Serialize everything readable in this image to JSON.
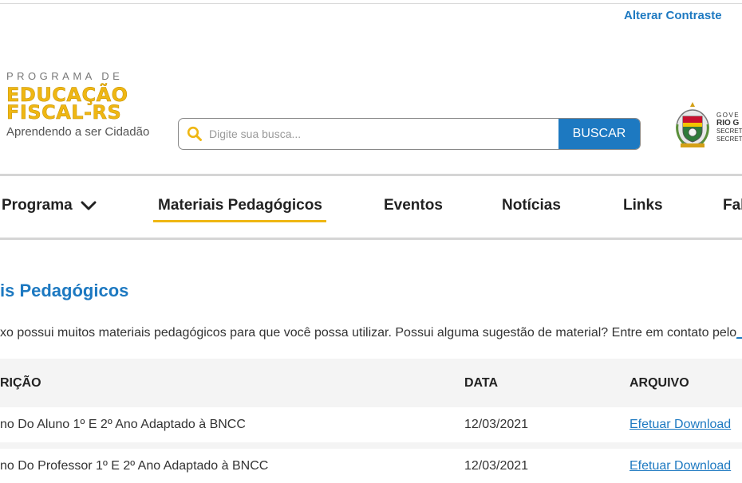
{
  "header": {
    "contrast_label": "Alterar Contraste",
    "logo": {
      "line1": "PROGRAMA DE",
      "line2": "EDUCAÇÃO",
      "line3": "FISCAL-RS",
      "tagline": "Aprendendo a ser Cidadão"
    },
    "search": {
      "placeholder": "Digite sua busca...",
      "button_label": "BUSCAR"
    },
    "gov": {
      "line1": "GOVE",
      "line2": "RIO G",
      "line3": "SECRETA",
      "line4": "SECRETA"
    }
  },
  "nav": {
    "items": [
      {
        "label": "Programa"
      },
      {
        "label": "Materiais Pedagógicos",
        "active": true
      },
      {
        "label": "Eventos"
      },
      {
        "label": "Notícias"
      },
      {
        "label": "Links"
      },
      {
        "label": "Fal"
      }
    ]
  },
  "main": {
    "title": "is Pedagógicos",
    "intro_text": "xo possui muitos materiais pedagógicos para que você possa utilizar. Possui alguma sugestão de material? Entre em contato pelo",
    "intro_link": "_",
    "table": {
      "headers": [
        "RIÇÃO",
        "DATA",
        "ARQUIVO"
      ],
      "rows": [
        {
          "description": "no Do Aluno 1º E 2º Ano Adaptado à BNCC",
          "date": "12/03/2021",
          "file": "Efetuar Download"
        },
        {
          "description": "no Do Professor 1º E 2º Ano Adaptado à BNCC",
          "date": "12/03/2021",
          "file": "Efetuar Download"
        }
      ]
    }
  },
  "colors": {
    "accent_blue": "#1d79c1",
    "brand_yellow": "#efb713",
    "table_header_bg": "#f4f4f4"
  },
  "icons": {
    "search": "search-icon",
    "chevron": "chevron-down-icon",
    "crest": "rs-crest-icon"
  }
}
